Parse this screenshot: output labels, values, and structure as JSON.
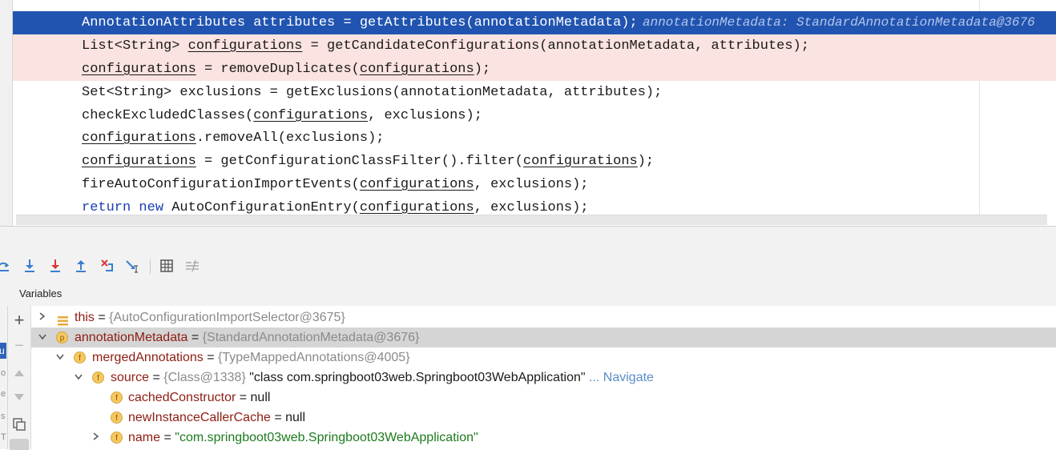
{
  "editor": {
    "brace": "}",
    "lines": [
      {
        "id": "l1",
        "parts": [
          "AnnotationAttributes attributes = getAttributes(annotationMetadata);"
        ],
        "hint": "annotationMetadata: StandardAnnotationMetadata@3676"
      },
      {
        "id": "l2",
        "a": "List<String> ",
        "b": "configurations",
        "c": " = getCandidateConfigurations(annotationMetadata, attributes);"
      },
      {
        "id": "l3",
        "a": "configurations",
        "b": " = removeDuplicates(",
        "c": "configurations",
        "d": ");"
      },
      {
        "id": "l4",
        "a": "Set<String> exclusions = getExclusions(annotationMetadata, attributes);"
      },
      {
        "id": "l5",
        "a": "checkExcludedClasses(",
        "b": "configurations",
        "c": ", exclusions);"
      },
      {
        "id": "l6",
        "a": "configurations",
        "b": ".removeAll(exclusions);"
      },
      {
        "id": "l7",
        "a": "configurations",
        "b": " = getConfigurationClassFilter().filter(",
        "c": "configurations",
        "d": ");"
      },
      {
        "id": "l8",
        "a": "fireAutoConfigurationImportEvents(",
        "b": "configurations",
        "c": ", exclusions);"
      },
      {
        "id": "l9",
        "kw1": "return",
        "kw2": "new",
        "a": " AutoConfigurationEntry(",
        "b": "configurations",
        "c": ", exclusions);"
      }
    ]
  },
  "debug": {
    "variables_title": "Variables",
    "left_strip_letters": [
      "u",
      "o",
      "e",
      "s",
      "T"
    ],
    "tree": [
      {
        "name": "this",
        "eq": " = ",
        "value": "{AutoConfigurationImportSelector@3675}",
        "badge": "",
        "icon": "fields-icon"
      },
      {
        "name": "annotationMetadata",
        "eq": " = ",
        "value": "{StandardAnnotationMetadata@3676}",
        "badge": "p"
      },
      {
        "name": "mergedAnnotations",
        "eq": " = ",
        "value": "{TypeMappedAnnotations@4005}",
        "badge": "f"
      },
      {
        "name": "source",
        "eq": " = ",
        "value": "{Class@1338}",
        "extra": " \"class com.springboot03web.Springboot03WebApplication\"",
        "link": "... Navigate",
        "badge": "f"
      },
      {
        "name": "cachedConstructor",
        "eq": " = ",
        "value": "null",
        "badge": "f"
      },
      {
        "name": "newInstanceCallerCache",
        "eq": " = ",
        "value": "null",
        "badge": "f"
      },
      {
        "name": "name",
        "eq": " = ",
        "value": "\"com.springboot03web.Springboot03WebApplication\"",
        "badge": "f"
      }
    ]
  },
  "colors": {
    "exec_line": "#2154b0",
    "breakpoint_line": "#fae3e0",
    "selected_row": "#d5d5d5",
    "keyword": "#1c3fb4",
    "variable_name": "#8c1d12"
  }
}
